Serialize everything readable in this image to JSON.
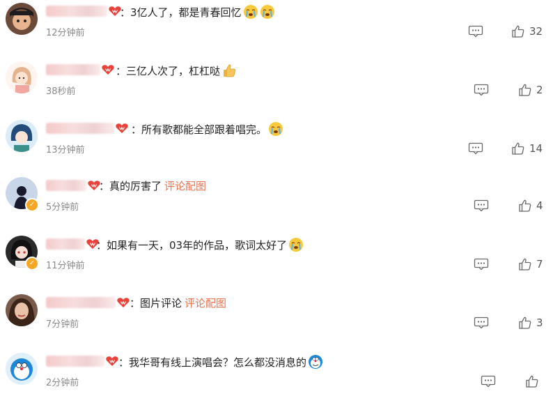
{
  "comments": [
    {
      "text": "：3亿人了，都是青春回忆",
      "emojis": [
        "crying-emoji",
        "crying-emoji"
      ],
      "link": "",
      "time": "12分钟前",
      "likes": "32",
      "verified": false,
      "avatar": "dark-hair-avatar"
    },
    {
      "text": "：三亿人次了，杠杠哒",
      "emojis": [
        "thumbs-up-emoji"
      ],
      "link": "",
      "time": "38秒前",
      "likes": "2",
      "verified": false,
      "avatar": "cartoon-girl-avatar"
    },
    {
      "text": "：所有歌都能全部跟着唱完。",
      "emojis": [
        "crying-emoji"
      ],
      "link": "",
      "time": "13分钟前",
      "likes": "14",
      "verified": false,
      "avatar": "blue-hair-avatar"
    },
    {
      "text": "：真的厉害了",
      "emojis": [],
      "link": "评论配图",
      "time": "5分钟前",
      "likes": "4",
      "verified": true,
      "avatar": "silhouette-avatar"
    },
    {
      "text": "：如果有一天，03年的作品，歌词太好了",
      "emojis": [
        "crying-emoji"
      ],
      "link": "",
      "time": "11分钟前",
      "likes": "7",
      "verified": true,
      "avatar": "anime-avatar"
    },
    {
      "text": "：图片评论",
      "emojis": [],
      "link": "评论配图",
      "time": "7分钟前",
      "likes": "3",
      "verified": false,
      "avatar": "photo-woman-avatar"
    },
    {
      "text": "：我华哥有线上演唱会？怎么都没消息的",
      "emojis": [
        "doraemon-emoji"
      ],
      "link": "",
      "time": "2分钟前",
      "likes": "",
      "verified": false,
      "avatar": "doraemon-avatar"
    }
  ],
  "colors": {
    "link": "#eb7350",
    "badge": "#e8423a",
    "verified": "#f5a623",
    "time": "#8a8a8a"
  }
}
